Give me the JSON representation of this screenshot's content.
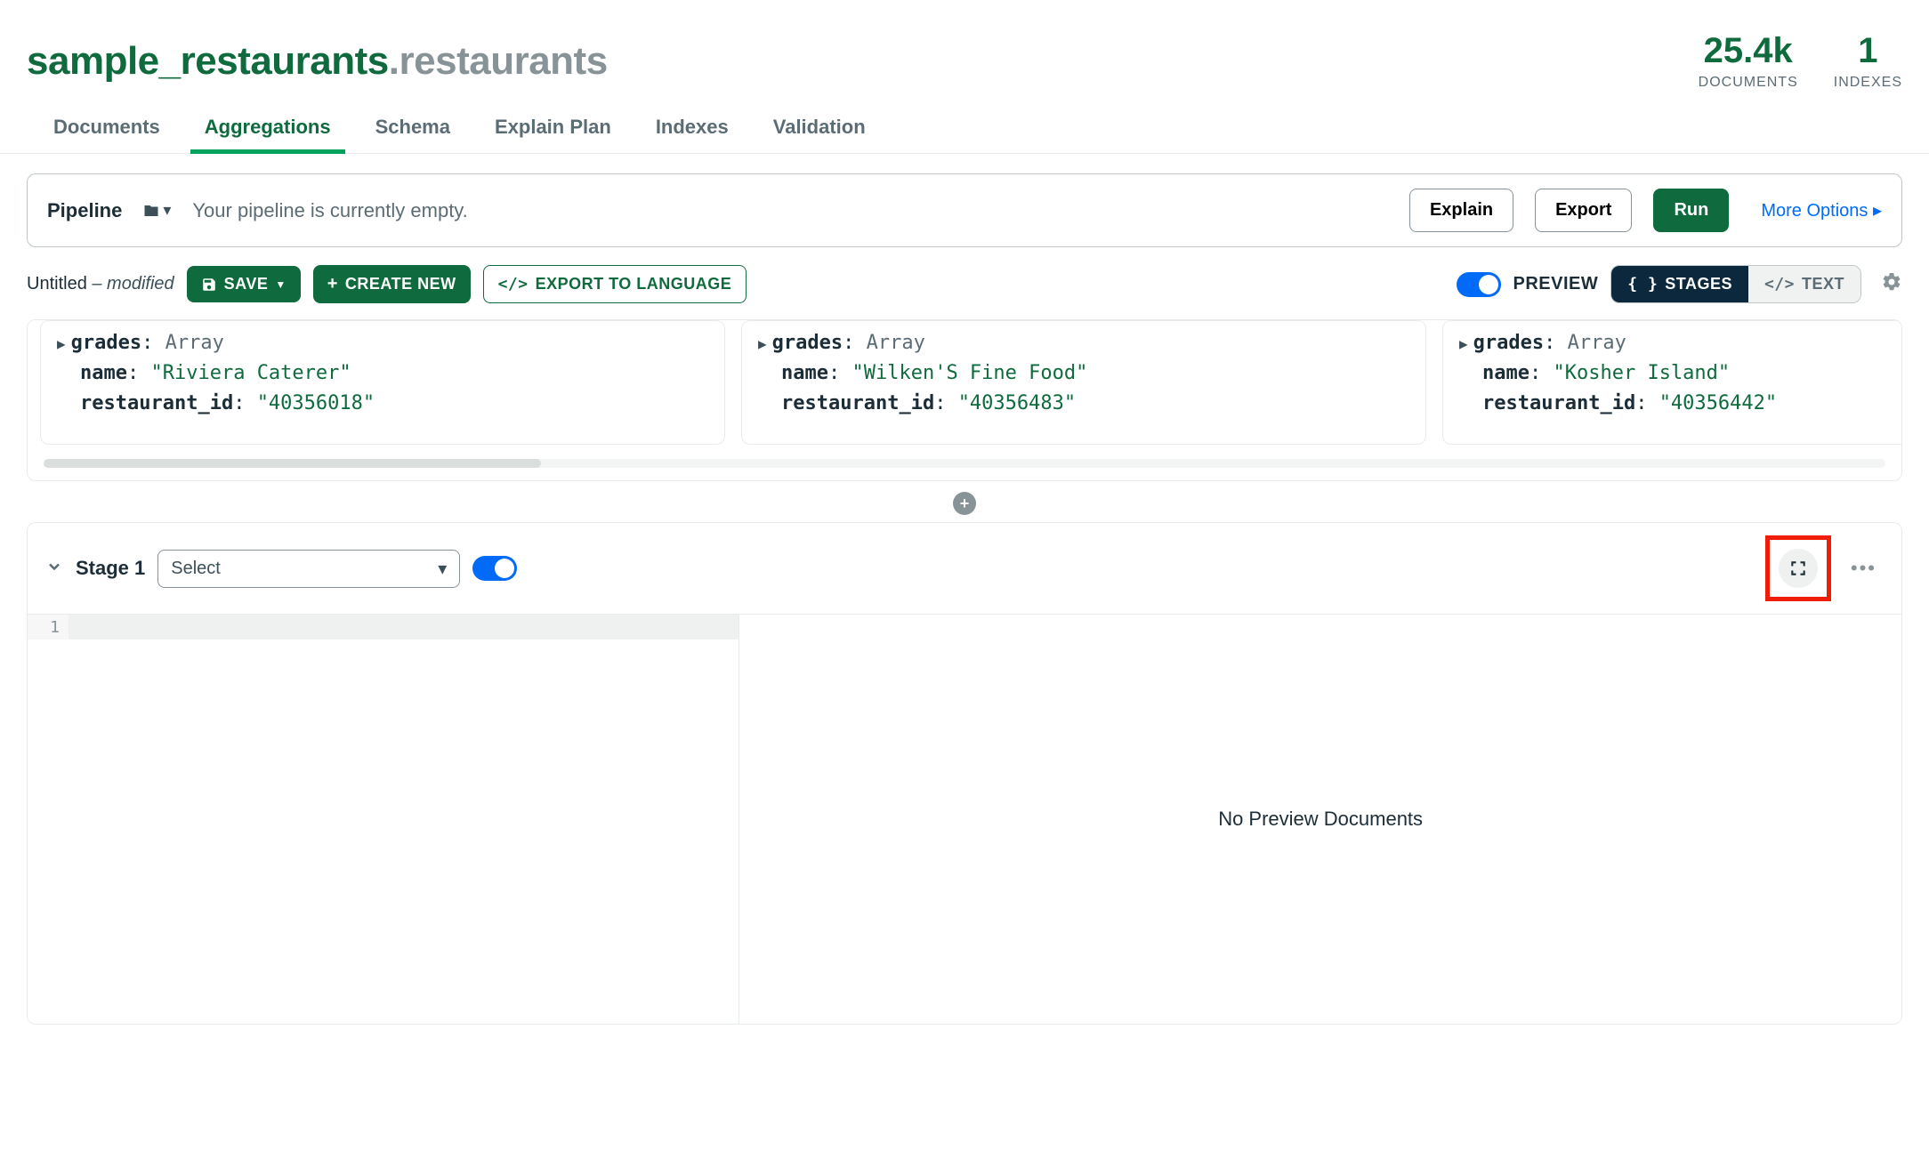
{
  "namespace": {
    "db": "sample_restaurants",
    "sep": ".",
    "coll": "restaurants"
  },
  "stats": {
    "documents": {
      "value": "25.4k",
      "label": "DOCUMENTS"
    },
    "indexes": {
      "value": "1",
      "label": "INDEXES"
    }
  },
  "tabs": [
    "Documents",
    "Aggregations",
    "Schema",
    "Explain Plan",
    "Indexes",
    "Validation"
  ],
  "active_tab_index": 1,
  "pipeline": {
    "label": "Pipeline",
    "empty_text": "Your pipeline is currently empty.",
    "explain": "Explain",
    "export": "Export",
    "run": "Run",
    "more_options": "More Options"
  },
  "toolbar": {
    "untitled": "Untitled",
    "modified": " – modified",
    "save": "SAVE",
    "create_new": "CREATE NEW",
    "export_lang": "EXPORT TO LANGUAGE",
    "preview": "PREVIEW",
    "stages": "STAGES",
    "text": "TEXT"
  },
  "preview_docs": [
    {
      "grades_label": "grades",
      "grades_type": "Array",
      "name_label": "name",
      "name_value": "\"Riviera Caterer\"",
      "rid_label": "restaurant_id",
      "rid_value": "\"40356018\""
    },
    {
      "grades_label": "grades",
      "grades_type": "Array",
      "name_label": "name",
      "name_value": "\"Wilken'S Fine Food\"",
      "rid_label": "restaurant_id",
      "rid_value": "\"40356483\""
    },
    {
      "grades_label": "grades",
      "grades_type": "Array",
      "name_label": "name",
      "name_value": "\"Kosher Island\"",
      "rid_label": "restaurant_id",
      "rid_value": "\"40356442\""
    }
  ],
  "stage": {
    "title": "Stage 1",
    "select_placeholder": "Select",
    "line_number": "1",
    "no_preview": "No Preview Documents"
  }
}
